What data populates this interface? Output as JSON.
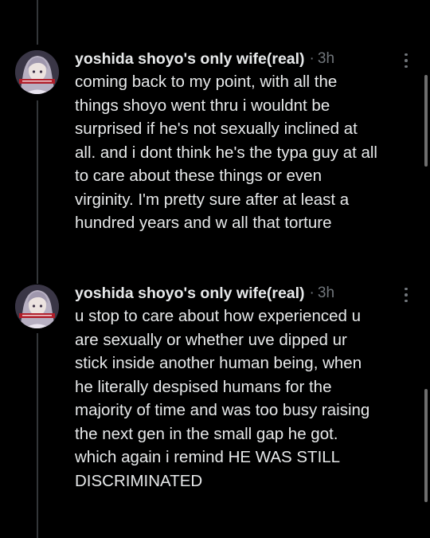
{
  "posts": [
    {
      "author": "yoshida shoyo's only wife(real)",
      "separator": "·",
      "time": "3h",
      "text": "coming back to my point, with all the\nthings shoyo went thru i wouldnt be\nsurprised if he's not sexually inclined at\nall. and i dont think he's the typa guy at all\nto care about these things or even\nvirginity. I'm pretty sure after at least a\nhundred years and w all that torture",
      "avatar_icon": "anime-profile-avatar-icon",
      "menu_icon": "more-options-vertical-icon"
    },
    {
      "author": "yoshida shoyo's only wife(real)",
      "separator": "·",
      "time": "3h",
      "text": "u stop to care about how experienced u\nare sexually or whether uve dipped ur\nstick inside another human being, when\nhe literally despised humans for the\nmajority of time and was too busy raising\nthe next gen in the small gap he got.\nwhich again i remind HE WAS STILL\nDISCRIMINATED",
      "avatar_icon": "anime-profile-avatar-icon",
      "menu_icon": "more-options-vertical-icon"
    }
  ],
  "colors": {
    "background": "#000000",
    "text": "#e7e9ea",
    "muted": "#71767b",
    "thread_line": "#333639"
  }
}
